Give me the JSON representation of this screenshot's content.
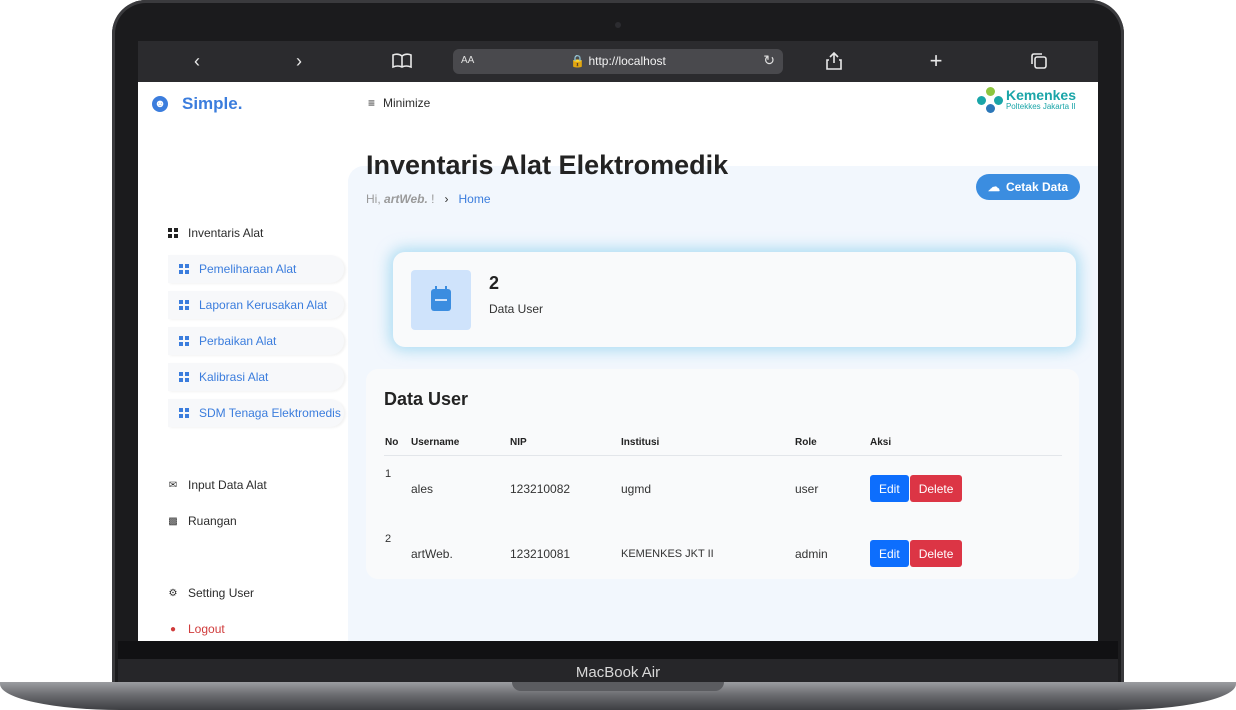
{
  "device": {
    "label": "MacBook Air"
  },
  "browser": {
    "aa_label": "AA",
    "url": "http://localhost",
    "lock_icon": "lock-icon"
  },
  "sidebar": {
    "brand": "Simple.",
    "items": [
      {
        "label": "Inventaris Alat",
        "icon": "grid-icon"
      },
      {
        "label": "Pemeliharaan Alat",
        "icon": "grid-icon"
      },
      {
        "label": "Laporan Kerusakan Alat",
        "icon": "grid-icon"
      },
      {
        "label": "Perbaikan Alat",
        "icon": "grid-icon"
      },
      {
        "label": "Kalibrasi Alat",
        "icon": "grid-icon"
      },
      {
        "label": "SDM Tenaga Elektromedis",
        "icon": "grid-icon"
      },
      {
        "label": "Input Data Alat",
        "icon": "envelope-icon"
      },
      {
        "label": "Ruangan",
        "icon": "chat-icon"
      },
      {
        "label": "Setting User",
        "icon": "gear-icon"
      },
      {
        "label": "Logout",
        "icon": "logout-icon"
      }
    ]
  },
  "topbar": {
    "minimize_label": "Minimize",
    "logo_line1": "Kemenkes",
    "logo_line2": "Poltekkes Jakarta II"
  },
  "header": {
    "title": "Inventaris Alat Elektromedik",
    "greeting_prefix": "Hi,",
    "user": "artWeb.",
    "greeting_suffix": "!",
    "breadcrumb_separator": "›",
    "breadcrumb_home": "Home",
    "print_button": "Cetak Data"
  },
  "stat": {
    "value": "2",
    "label": "Data User"
  },
  "table": {
    "title": "Data User",
    "columns": [
      "No",
      "Username",
      "NIP",
      "Institusi",
      "Role",
      "Aksi"
    ],
    "rows": [
      {
        "no": "1",
        "username": "ales",
        "nip": "123210082",
        "institusi": "ugmd",
        "role": "user",
        "edit": "Edit",
        "delete": "Delete"
      },
      {
        "no": "2",
        "username": "artWeb.",
        "nip": "123210081",
        "institusi": "KEMENKES JKT II",
        "role": "admin",
        "edit": "Edit",
        "delete": "Delete"
      }
    ]
  }
}
